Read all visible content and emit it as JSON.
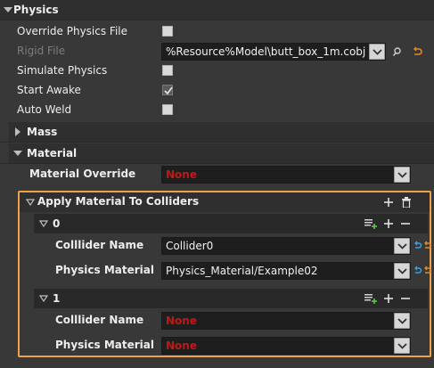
{
  "physics": {
    "title": "Physics",
    "override_physics_file_label": "Override Physics File",
    "rigid_file_label": "Rigid File",
    "rigid_file_value": "%Resource%Model\\butt_box_1m.cobj",
    "simulate_physics_label": "Simulate Physics",
    "start_awake_label": "Start Awake",
    "start_awake_checked": true,
    "auto_weld_label": "Auto Weld"
  },
  "mass": {
    "title": "Mass"
  },
  "material": {
    "title": "Material",
    "override_label": "Material Override",
    "override_value": "None"
  },
  "apply_material": {
    "title": "Apply Material To Colliders",
    "entries": [
      {
        "index": "0",
        "collider_name_label": "Colllider Name",
        "collider_name_value": "Collider0",
        "physics_material_label": "Physics Material",
        "physics_material_value": "Physics_Material/Example02"
      },
      {
        "index": "1",
        "collider_name_label": "Colllider Name",
        "collider_name_value": "None",
        "physics_material_label": "Physics Material",
        "physics_material_value": "None"
      }
    ]
  },
  "colors": {
    "accent_outline": "#f0a24a",
    "none_value": "#c01818",
    "reset_icon": "#e08a2c",
    "browse_icon": "#3aa0e0"
  },
  "icons": [
    "triangle-down-icon",
    "triangle-right-icon",
    "search-icon",
    "reset-arrow-icon",
    "plus-icon",
    "trash-icon",
    "minus-icon",
    "add-element-icon",
    "chevron-down-icon",
    "browse-arrow-icon"
  ]
}
